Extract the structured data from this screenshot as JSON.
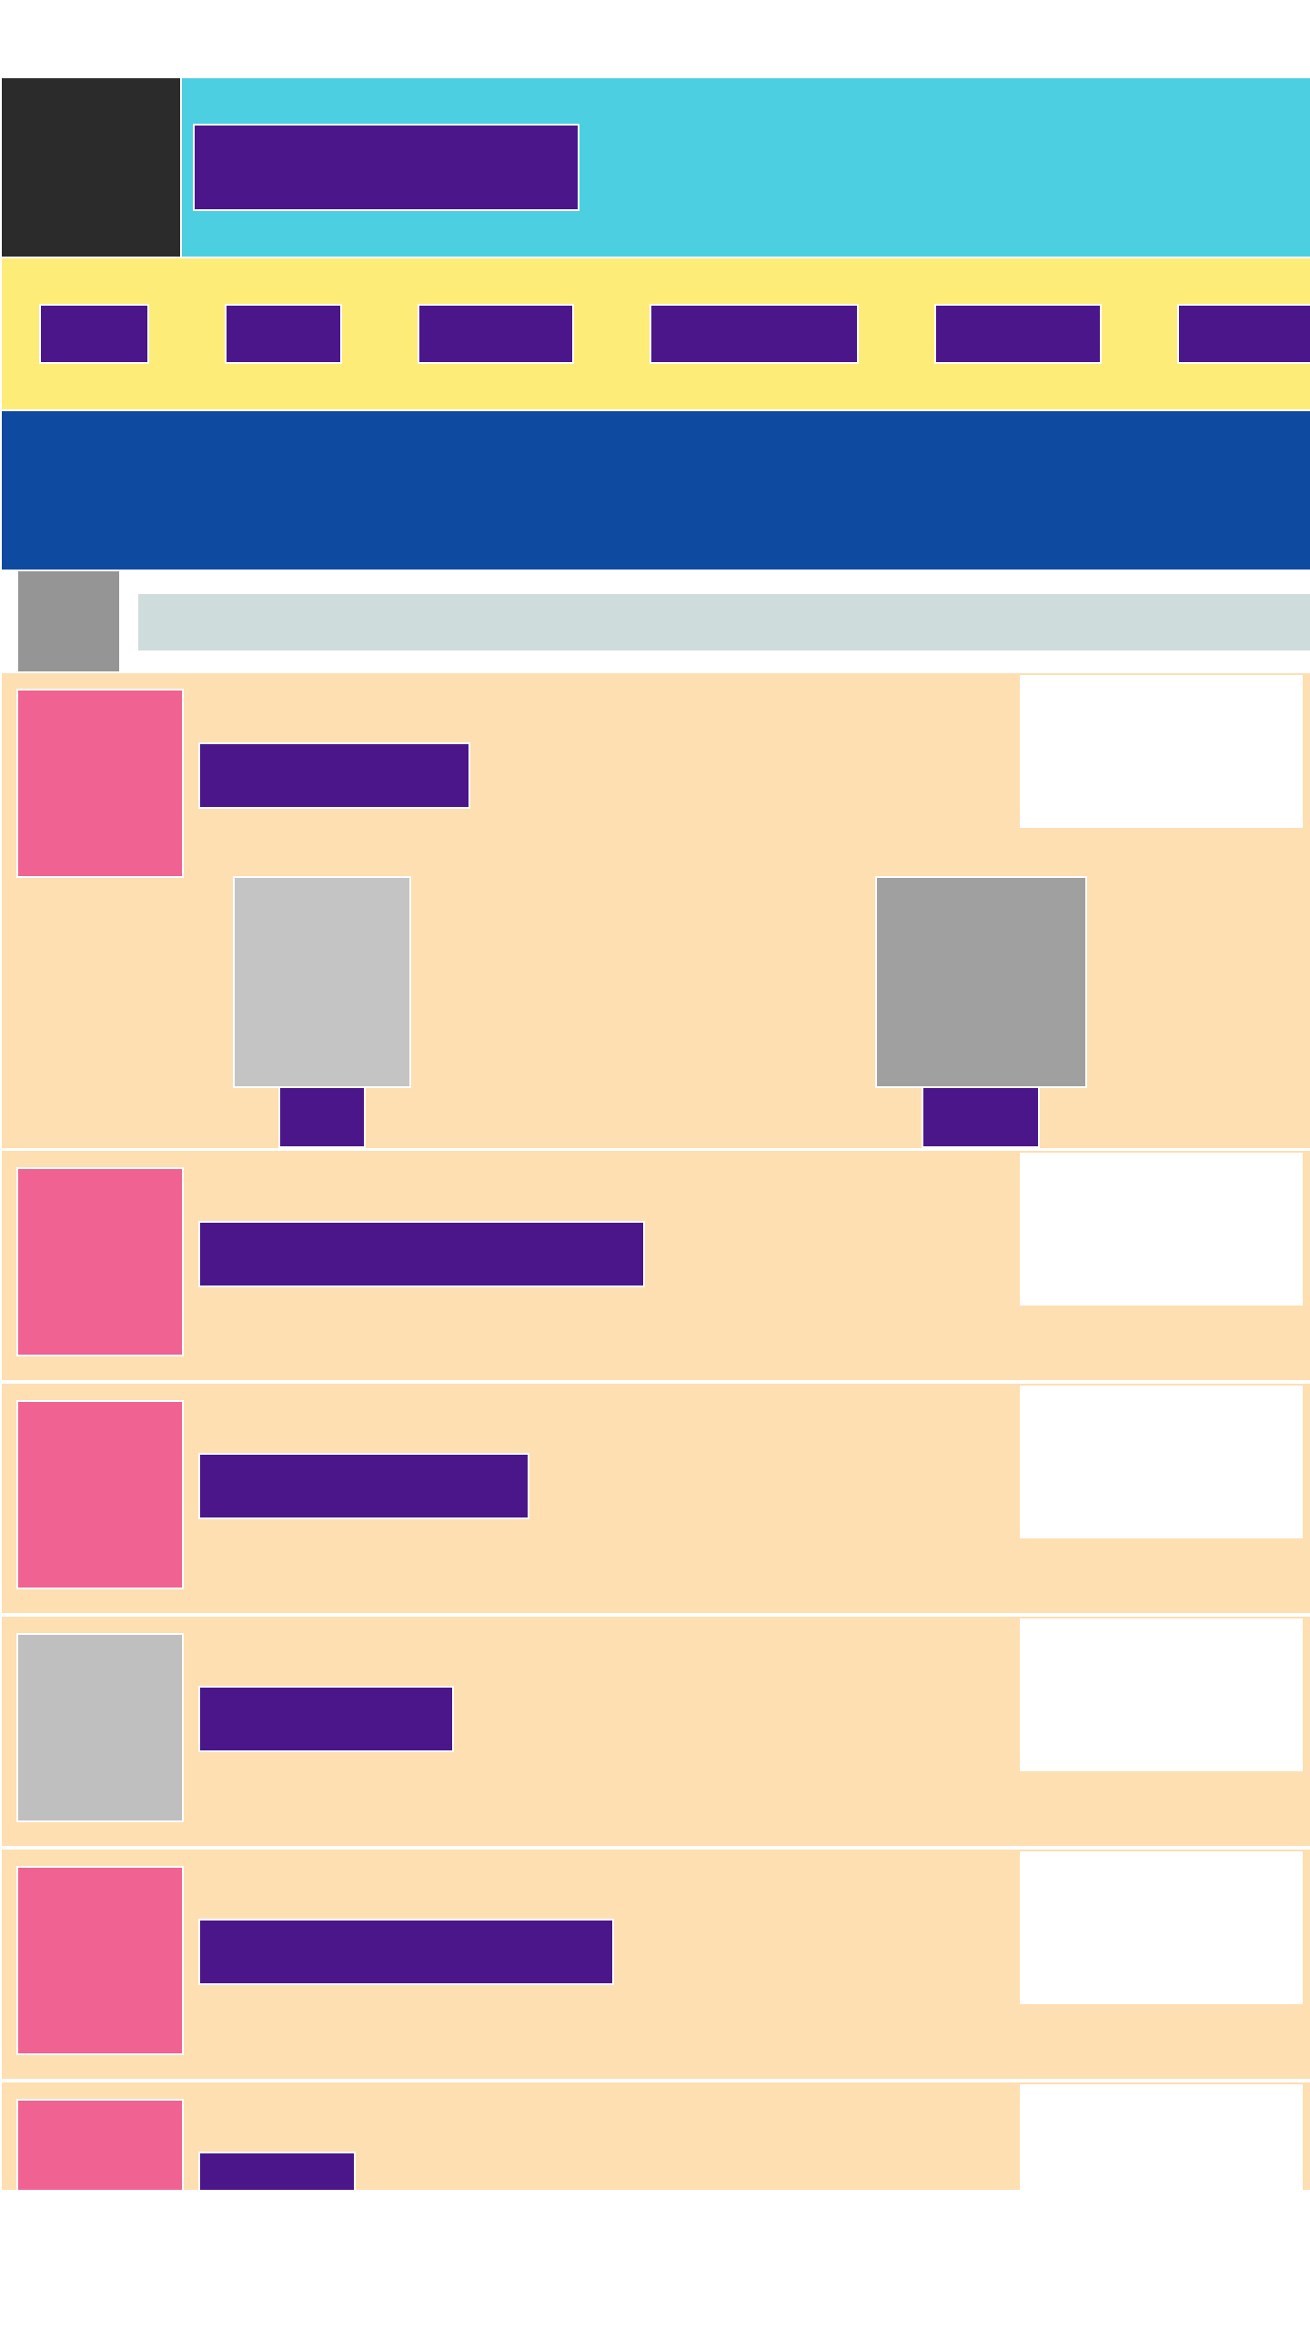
{
  "header": {
    "logo_alt": "",
    "title": ""
  },
  "nav": {
    "items": [
      {
        "label": ""
      },
      {
        "label": ""
      },
      {
        "label": ""
      },
      {
        "label": ""
      },
      {
        "label": ""
      },
      {
        "label": ""
      }
    ]
  },
  "search": {
    "placeholder": ""
  },
  "feed": {
    "cards": [
      {
        "title": "",
        "thumbnail": "pink",
        "sub_items": [
          {
            "label": ""
          },
          {
            "label": ""
          }
        ]
      },
      {
        "title": "",
        "thumbnail": "pink"
      },
      {
        "title": "",
        "thumbnail": "pink"
      },
      {
        "title": "",
        "thumbnail": "light-gray"
      },
      {
        "title": "",
        "thumbnail": "pink"
      },
      {
        "title": "",
        "thumbnail": "pink"
      }
    ]
  },
  "colors": {
    "text_block": "#4a168a",
    "header": "#4ccfe1",
    "nav": "#fded78",
    "hero": "#0f4aa1",
    "card": "#fddfb2",
    "thumbnail_pink": "#f06292",
    "logo": "#2b2b2b"
  }
}
